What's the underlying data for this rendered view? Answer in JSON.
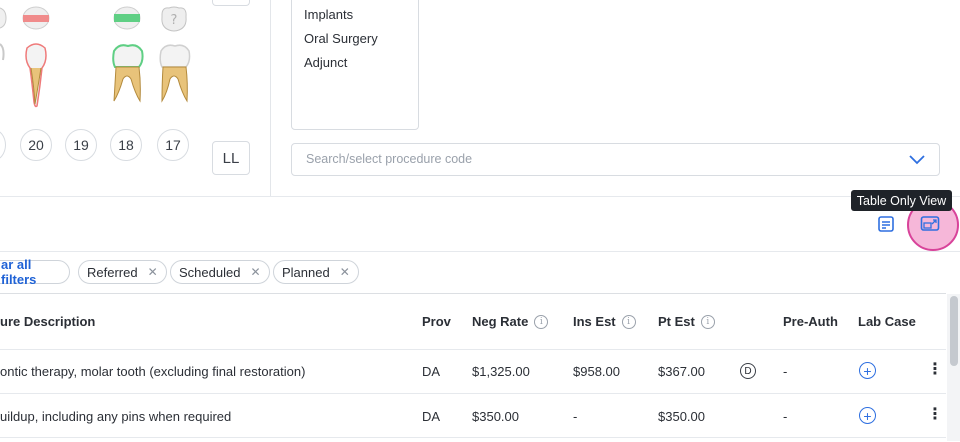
{
  "tooth_chart": {
    "tooth_numbers": [
      "20",
      "19",
      "18",
      "17"
    ],
    "quadrant_label": "LL"
  },
  "categories": {
    "items": [
      "Implants",
      "Oral Surgery",
      "Adjunct"
    ]
  },
  "procedure_search": {
    "placeholder": "Search/select procedure code"
  },
  "toolbar": {
    "tooltip": "Table Only View",
    "icons": [
      "notes-icon",
      "table-only-view-icon"
    ]
  },
  "filters": {
    "clear_label": "ar all filters",
    "chips": [
      "Referred",
      "Scheduled",
      "Planned"
    ]
  },
  "table": {
    "headers": {
      "description": "ure Description",
      "prov": "Prov",
      "neg_rate": "Neg Rate",
      "ins_est": "Ins Est",
      "pt_est": "Pt Est",
      "pre_auth": "Pre-Auth",
      "lab_case": "Lab Case"
    },
    "rows": [
      {
        "description": "ontic therapy, molar tooth (excluding final restoration)",
        "prov": "DA",
        "neg_rate": "$1,325.00",
        "ins_est": "$958.00",
        "pt_est": "$367.00",
        "badge": "D",
        "pre_auth": "-"
      },
      {
        "description": "uildup, including any pins when required",
        "prov": "DA",
        "neg_rate": "$350.00",
        "ins_est": "-",
        "pt_est": "$350.00",
        "pre_auth": "-"
      }
    ]
  },
  "colors": {
    "accent": "#1f62d6",
    "highlight": "#d8439a",
    "tooltip_bg": "#1f2329"
  }
}
